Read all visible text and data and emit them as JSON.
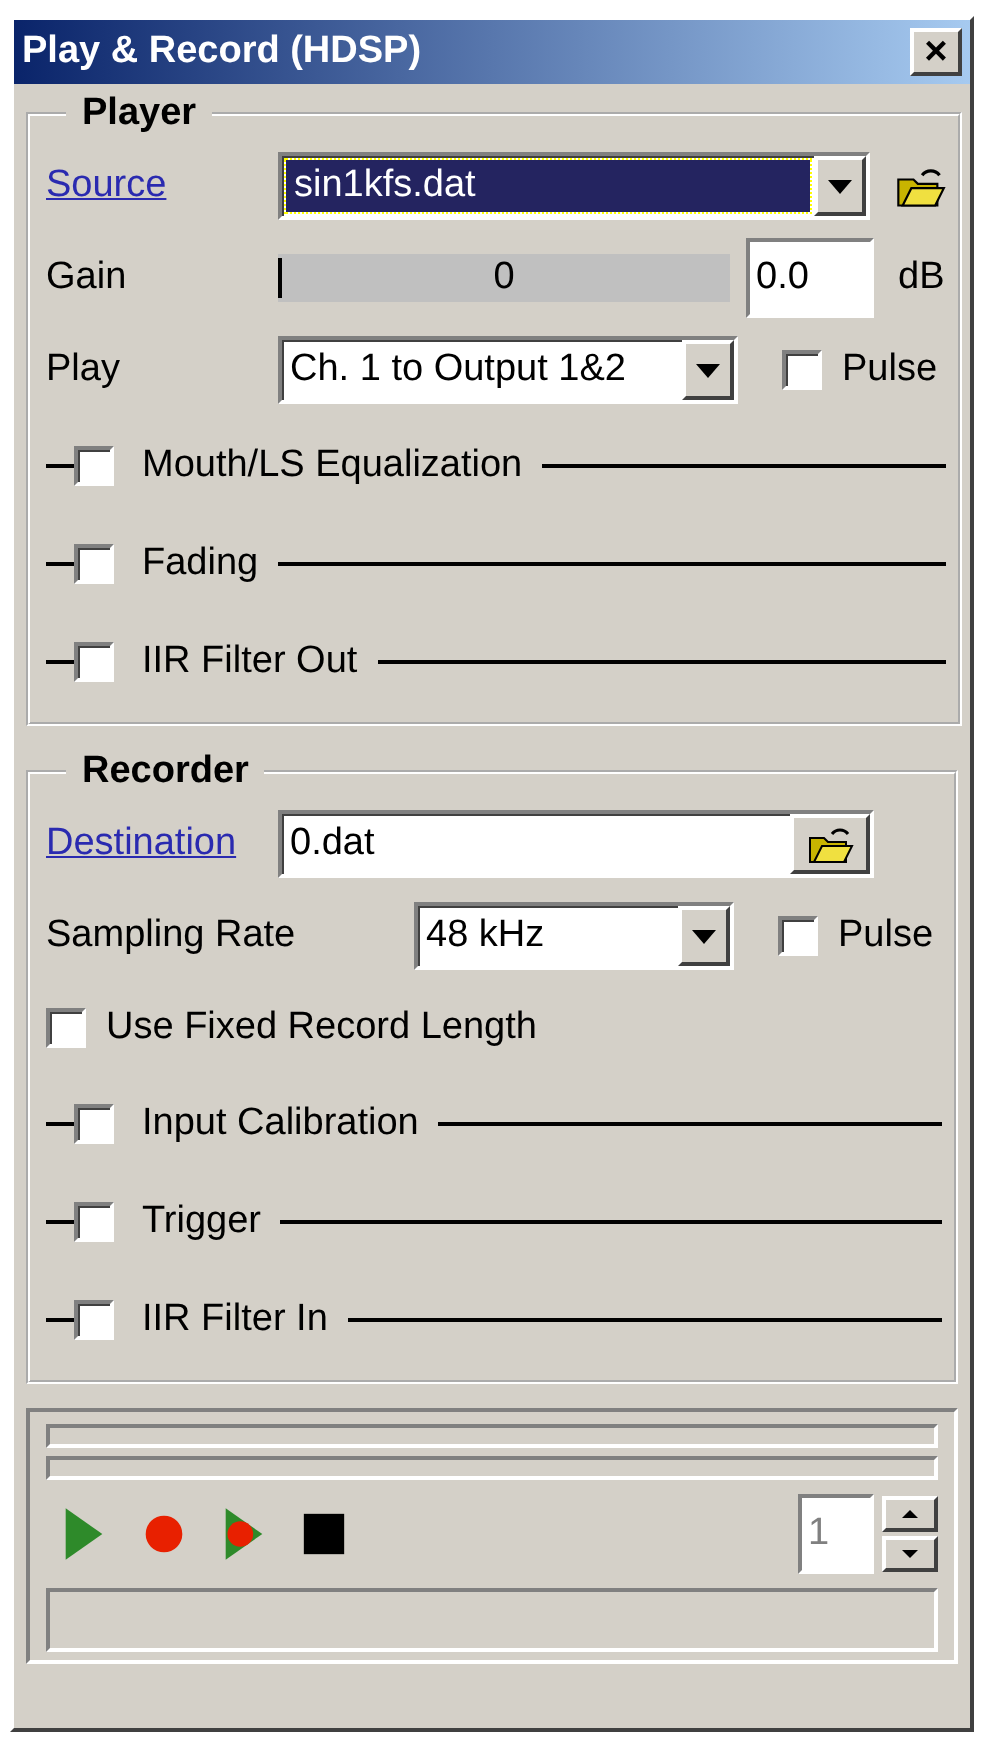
{
  "window": {
    "title": "Play & Record (HDSP)",
    "close": "×"
  },
  "player": {
    "title": "Player",
    "source": {
      "label": "Source",
      "value": "sin1kfs.dat"
    },
    "gain": {
      "label": "Gain",
      "slider_text": "0",
      "level": 0,
      "value": "0.0",
      "unit": "dB"
    },
    "play": {
      "label": "Play",
      "value": "Ch. 1 to Output 1&2",
      "pulse": {
        "label": "Pulse",
        "checked": false
      }
    },
    "sections": [
      {
        "label": "Mouth/LS Equalization",
        "checked": false
      },
      {
        "label": "Fading",
        "checked": false
      },
      {
        "label": "IIR Filter Out",
        "checked": false
      }
    ]
  },
  "recorder": {
    "title": "Recorder",
    "destination": {
      "label": "Destination",
      "value": "0.dat"
    },
    "sampling_rate": {
      "label": "Sampling Rate",
      "value": "48 kHz",
      "pulse": {
        "label": "Pulse",
        "checked": false
      }
    },
    "fixed_length": {
      "label": "Use Fixed Record Length",
      "checked": false
    },
    "sections": [
      {
        "label": "Input Calibration",
        "checked": false
      },
      {
        "label": "Trigger",
        "checked": false
      },
      {
        "label": "IIR Filter In",
        "checked": false
      }
    ]
  },
  "transport": {
    "progress": [
      {
        "level": 0
      },
      {
        "level": 0
      }
    ],
    "buttons": [
      {
        "kind": "play"
      },
      {
        "kind": "record"
      },
      {
        "kind": "play-record"
      },
      {
        "kind": "stop"
      }
    ],
    "count": "1"
  }
}
